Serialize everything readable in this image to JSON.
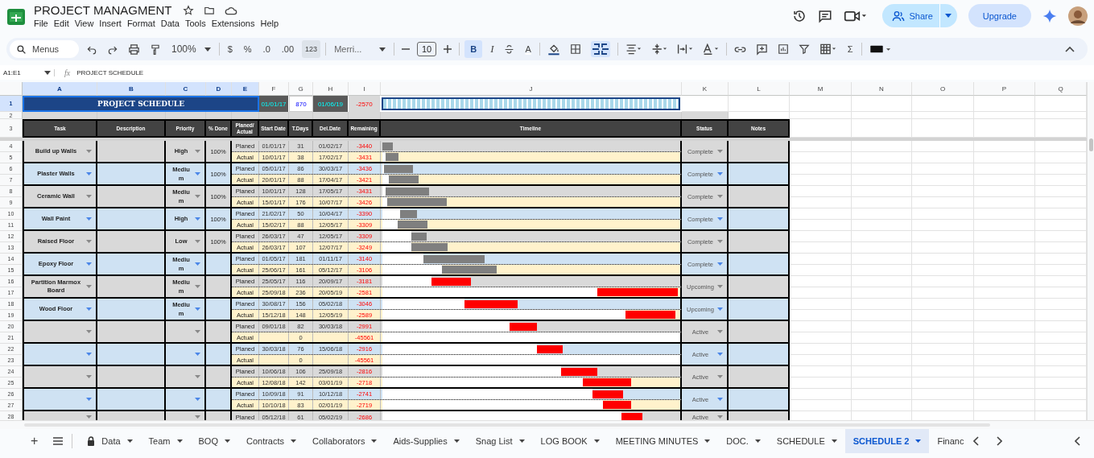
{
  "doc": {
    "title": "PROJECT MANAGMENT",
    "menu": [
      "File",
      "Edit",
      "View",
      "Insert",
      "Format",
      "Data",
      "Tools",
      "Extensions",
      "Help"
    ],
    "share": "Share",
    "upgrade": "Upgrade"
  },
  "toolbar": {
    "search_placeholder": "Menus",
    "zoom": "100%",
    "currency": "$",
    "percent": "%",
    "dec_less": ".0",
    "dec_more": ".00",
    "number_format": "123",
    "font": "Merri...",
    "font_size": "10",
    "bold": "B",
    "bold_on": true,
    "italic": "I",
    "text_color": "A",
    "merge_on": true,
    "sum": "Σ"
  },
  "formula_bar": {
    "cell_range": "A1:E1",
    "fx": "fx",
    "content": "PROJECT SCHEDULE"
  },
  "sheet": {
    "columns": [
      {
        "label": "A",
        "selected": true
      },
      {
        "label": "B",
        "selected": true
      },
      {
        "label": "C",
        "selected": true
      },
      {
        "label": "D",
        "selected": true
      },
      {
        "label": "E",
        "selected": true
      },
      {
        "label": "F",
        "selected": false
      },
      {
        "label": "G",
        "selected": false
      },
      {
        "label": "H",
        "selected": false
      },
      {
        "label": "I",
        "selected": false
      },
      {
        "label": "J",
        "selected": false
      },
      {
        "label": "K",
        "selected": false
      },
      {
        "label": "L",
        "selected": false
      },
      {
        "label": "M",
        "selected": false
      },
      {
        "label": "N",
        "selected": false
      },
      {
        "label": "O",
        "selected": false
      },
      {
        "label": "P",
        "selected": false
      },
      {
        "label": "Q",
        "selected": false
      }
    ],
    "top_rows": [
      {
        "number": "1",
        "selected": true
      },
      {
        "number": "2",
        "selected": false
      },
      {
        "number": "3",
        "selected": false
      }
    ],
    "title_row": {
      "title": "PROJECT SCHEDULE",
      "start": "01/01/17",
      "total_days": "870",
      "end": "01/06/19",
      "remaining": "-2570",
      "level": 1
    },
    "header": [
      "Task",
      "Description",
      "Priority",
      "% Done",
      "Planed/ Actual",
      "Start Date",
      "T.Days",
      "Del.Date",
      "Remaining",
      "Timeline",
      "Status",
      "Notes"
    ],
    "tasks": [
      {
        "task": "Build up Walls",
        "priority": "High",
        "done": "100%",
        "status": "Complete",
        "color": "#7f7f7f",
        "rows": [
          {
            "number": "4",
            "selected": false,
            "label": "Planed",
            "start": "01/01/17",
            "days": "31",
            "end": "01/02/17",
            "remaining": "-3440"
          },
          {
            "number": "5",
            "selected": false,
            "label": "Actual",
            "start": "10/01/17",
            "days": "38",
            "end": "17/02/17",
            "remaining": "-3431"
          }
        ]
      },
      {
        "task": "Plaster Walls",
        "priority": "Medium",
        "done": "100%",
        "status": "Complete",
        "color": "#7f7f7f",
        "rows": [
          {
            "number": "6",
            "selected": false,
            "label": "Planed",
            "start": "05/01/17",
            "days": "86",
            "end": "30/03/17",
            "remaining": "-3436"
          },
          {
            "number": "7",
            "selected": false,
            "label": "Actual",
            "start": "20/01/17",
            "days": "88",
            "end": "17/04/17",
            "remaining": "-3421"
          }
        ]
      },
      {
        "task": "Ceramic Wall",
        "priority": "Medium",
        "done": "100%",
        "status": "Complete",
        "color": "#7f7f7f",
        "rows": [
          {
            "number": "8",
            "selected": false,
            "label": "Planed",
            "start": "10/01/17",
            "days": "128",
            "end": "17/05/17",
            "remaining": "-3431"
          },
          {
            "number": "9",
            "selected": false,
            "label": "Actual",
            "start": "15/01/17",
            "days": "176",
            "end": "10/07/17",
            "remaining": "-3426"
          }
        ]
      },
      {
        "task": "Wall Paint",
        "priority": "High",
        "done": "100%",
        "status": "Complete",
        "color": "#7f7f7f",
        "rows": [
          {
            "number": "10",
            "selected": false,
            "label": "Planed",
            "start": "21/02/17",
            "days": "50",
            "end": "10/04/17",
            "remaining": "-3390"
          },
          {
            "number": "11",
            "selected": false,
            "label": "Actual",
            "start": "15/02/17",
            "days": "88",
            "end": "12/05/17",
            "remaining": "-3309"
          }
        ]
      },
      {
        "task": "Raised Floor",
        "priority": "Low",
        "done": "100%",
        "status": "Complete",
        "color": "#7f7f7f",
        "rows": [
          {
            "number": "12",
            "selected": false,
            "label": "Planed",
            "start": "26/03/17",
            "days": "47",
            "end": "12/05/17",
            "remaining": "-3309"
          },
          {
            "number": "13",
            "selected": false,
            "label": "Actual",
            "start": "26/03/17",
            "days": "107",
            "end": "12/07/17",
            "remaining": "-3249"
          }
        ]
      },
      {
        "task": "Epoxy Floor",
        "priority": "Medium",
        "status": "Complete",
        "color": "#7f7f7f",
        "rows": [
          {
            "number": "14",
            "selected": false,
            "label": "Planed",
            "start": "01/05/17",
            "days": "181",
            "end": "01/11/17",
            "remaining": "-3140"
          },
          {
            "number": "15",
            "selected": false,
            "label": "Actual",
            "start": "25/06/17",
            "days": "161",
            "end": "05/12/17",
            "remaining": "-3106"
          }
        ]
      },
      {
        "task": "Partition Marmox Board",
        "priority": "Medium",
        "status": "Upcoming",
        "color": "#ff0000",
        "rows": [
          {
            "number": "16",
            "selected": false,
            "label": "Planed",
            "start": "25/05/17",
            "days": "116",
            "end": "20/09/17",
            "remaining": "-3181"
          },
          {
            "number": "17",
            "selected": false,
            "label": "Actual",
            "start": "25/09/18",
            "days": "236",
            "end": "20/05/19",
            "remaining": "-2581"
          }
        ]
      },
      {
        "task": "Wood Floor",
        "priority": "Medium",
        "status": "Upcoming",
        "color": "#ff0000",
        "rows": [
          {
            "number": "18",
            "selected": false,
            "label": "Planed",
            "start": "30/08/17",
            "days": "156",
            "end": "05/02/18",
            "remaining": "-3046"
          },
          {
            "number": "19",
            "selected": false,
            "label": "Actual",
            "start": "15/12/18",
            "days": "148",
            "end": "12/05/19",
            "remaining": "-2589"
          }
        ]
      },
      {
        "status": "Active",
        "color": "#ff0000",
        "rows": [
          {
            "number": "20",
            "selected": false,
            "label": "Planed",
            "start": "09/01/18",
            "days": "82",
            "end": "30/03/18",
            "remaining": "-2991"
          },
          {
            "number": "21",
            "selected": false,
            "label": "Actual",
            "days": "0",
            "remaining": "-45561"
          }
        ]
      },
      {
        "status": "Active",
        "color": "#ff0000",
        "rows": [
          {
            "number": "22",
            "selected": false,
            "label": "Planed",
            "start": "30/03/18",
            "days": "76",
            "end": "15/06/18",
            "remaining": "-2916"
          },
          {
            "number": "23",
            "selected": false,
            "label": "Actual",
            "days": "0",
            "remaining": "-45561"
          }
        ]
      },
      {
        "status": "Active",
        "color": "#ff0000",
        "rows": [
          {
            "number": "24",
            "selected": false,
            "label": "Planed",
            "start": "10/06/18",
            "days": "106",
            "end": "25/09/18",
            "remaining": "-2816"
          },
          {
            "number": "25",
            "selected": false,
            "label": "Actual",
            "start": "12/08/18",
            "days": "142",
            "end": "03/01/19",
            "remaining": "-2718"
          }
        ]
      },
      {
        "status": "Active",
        "color": "#ff0000",
        "rows": [
          {
            "number": "26",
            "selected": false,
            "label": "Planed",
            "start": "10/09/18",
            "days": "91",
            "end": "10/12/18",
            "remaining": "-2741"
          },
          {
            "number": "27",
            "selected": false,
            "label": "Actual",
            "start": "10/10/18",
            "days": "83",
            "end": "02/01/19",
            "remaining": "-2719"
          }
        ]
      },
      {
        "status": "Active",
        "color": "#ff0000",
        "rows": [
          {
            "number": "28",
            "selected": false,
            "label": "Planed",
            "start": "05/12/18",
            "days": "61",
            "end": "05/02/19",
            "remaining": "-2686"
          }
        ]
      }
    ]
  },
  "tabs": [
    {
      "label": "Data",
      "locked": true,
      "selected": false
    },
    {
      "label": "Team",
      "locked": false,
      "selected": false
    },
    {
      "label": "BOQ",
      "locked": false,
      "selected": false
    },
    {
      "label": "Contracts",
      "locked": false,
      "selected": false
    },
    {
      "label": "Collaborators",
      "locked": false,
      "selected": false
    },
    {
      "label": "Aids-Supplies",
      "locked": false,
      "selected": false
    },
    {
      "label": "Snag List",
      "locked": false,
      "selected": false
    },
    {
      "label": "LOG BOOK",
      "locked": false,
      "selected": false
    },
    {
      "label": "MEETING MINUTES",
      "locked": false,
      "selected": false
    },
    {
      "label": "DOC.",
      "locked": false,
      "selected": false
    },
    {
      "label": "SCHEDULE",
      "locked": false,
      "selected": false
    },
    {
      "label": "SCHEDULE 2",
      "locked": false,
      "selected": true
    },
    {
      "label": "Financ",
      "locked": false,
      "selected": false,
      "cut": true
    }
  ],
  "add_sheet": "+"
}
